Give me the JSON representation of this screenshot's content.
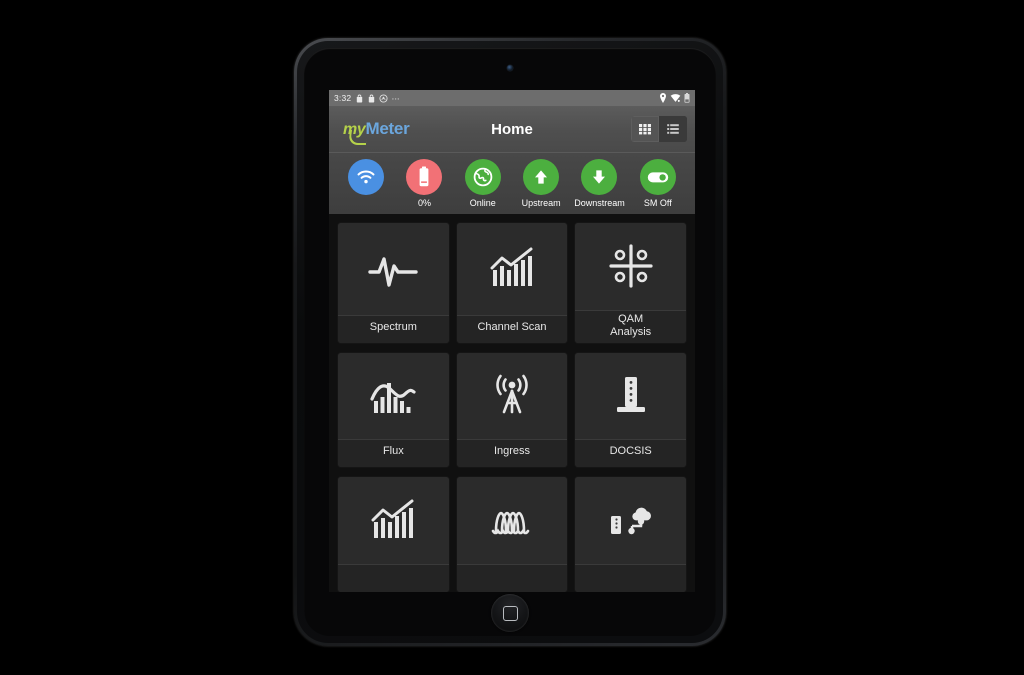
{
  "device": {
    "kind": "tablet",
    "camera": "front-camera",
    "home_button": "home-button"
  },
  "statusbar": {
    "time": "3:32",
    "left_icons": [
      "notification-icon",
      "notification-icon",
      "app-notification-icon",
      "more-notifications-icon"
    ],
    "right_icons": [
      "location-icon",
      "wifi-icon",
      "battery-icon"
    ]
  },
  "titlebar": {
    "logo_prefix": "my",
    "logo_suffix": "Meter",
    "title": "Home",
    "logo_color_prefix": "#b5d24a",
    "logo_color_suffix": "#6ba6dd",
    "view_buttons": [
      {
        "name": "grid-view-button",
        "icon": "grid-icon",
        "active": true
      },
      {
        "name": "list-view-button",
        "icon": "list-icon",
        "active": false
      }
    ]
  },
  "status_chips": [
    {
      "icon": "wifi-icon",
      "label": "",
      "color": "#4a90e2"
    },
    {
      "icon": "battery-icon",
      "label": "0%",
      "color": "#f27176"
    },
    {
      "icon": "globe-icon",
      "label": "Online",
      "color": "#4caf3f"
    },
    {
      "icon": "arrow-up-icon",
      "label": "Upstream",
      "color": "#4caf3f"
    },
    {
      "icon": "arrow-down-icon",
      "label": "Downstream",
      "color": "#4caf3f"
    },
    {
      "icon": "toggle-icon",
      "label": "SM Off",
      "color": "#4caf3f"
    }
  ],
  "tiles": [
    {
      "icon": "waveform-icon",
      "label": "Spectrum"
    },
    {
      "icon": "bar-chart-trend-icon",
      "label": "Channel Scan"
    },
    {
      "icon": "constellation-icon",
      "label": "QAM\nAnalysis"
    },
    {
      "icon": "flux-curve-icon",
      "label": "Flux"
    },
    {
      "icon": "antenna-tower-icon",
      "label": "Ingress"
    },
    {
      "icon": "modem-tower-icon",
      "label": "DOCSIS"
    },
    {
      "icon": "bar-chart-trend-icon",
      "label": ""
    },
    {
      "icon": "ofdm-carriers-icon",
      "label": ""
    },
    {
      "icon": "cloud-device-icon",
      "label": ""
    }
  ],
  "colors": {
    "background": "#000000",
    "screen_bg": "#101010",
    "titlebar": "#4f4f4f",
    "statusbar": "#6d6d6d",
    "tile": "#2a2a2a",
    "accent_green": "#4caf3f",
    "accent_blue": "#4a90e2",
    "accent_red": "#f27176"
  }
}
